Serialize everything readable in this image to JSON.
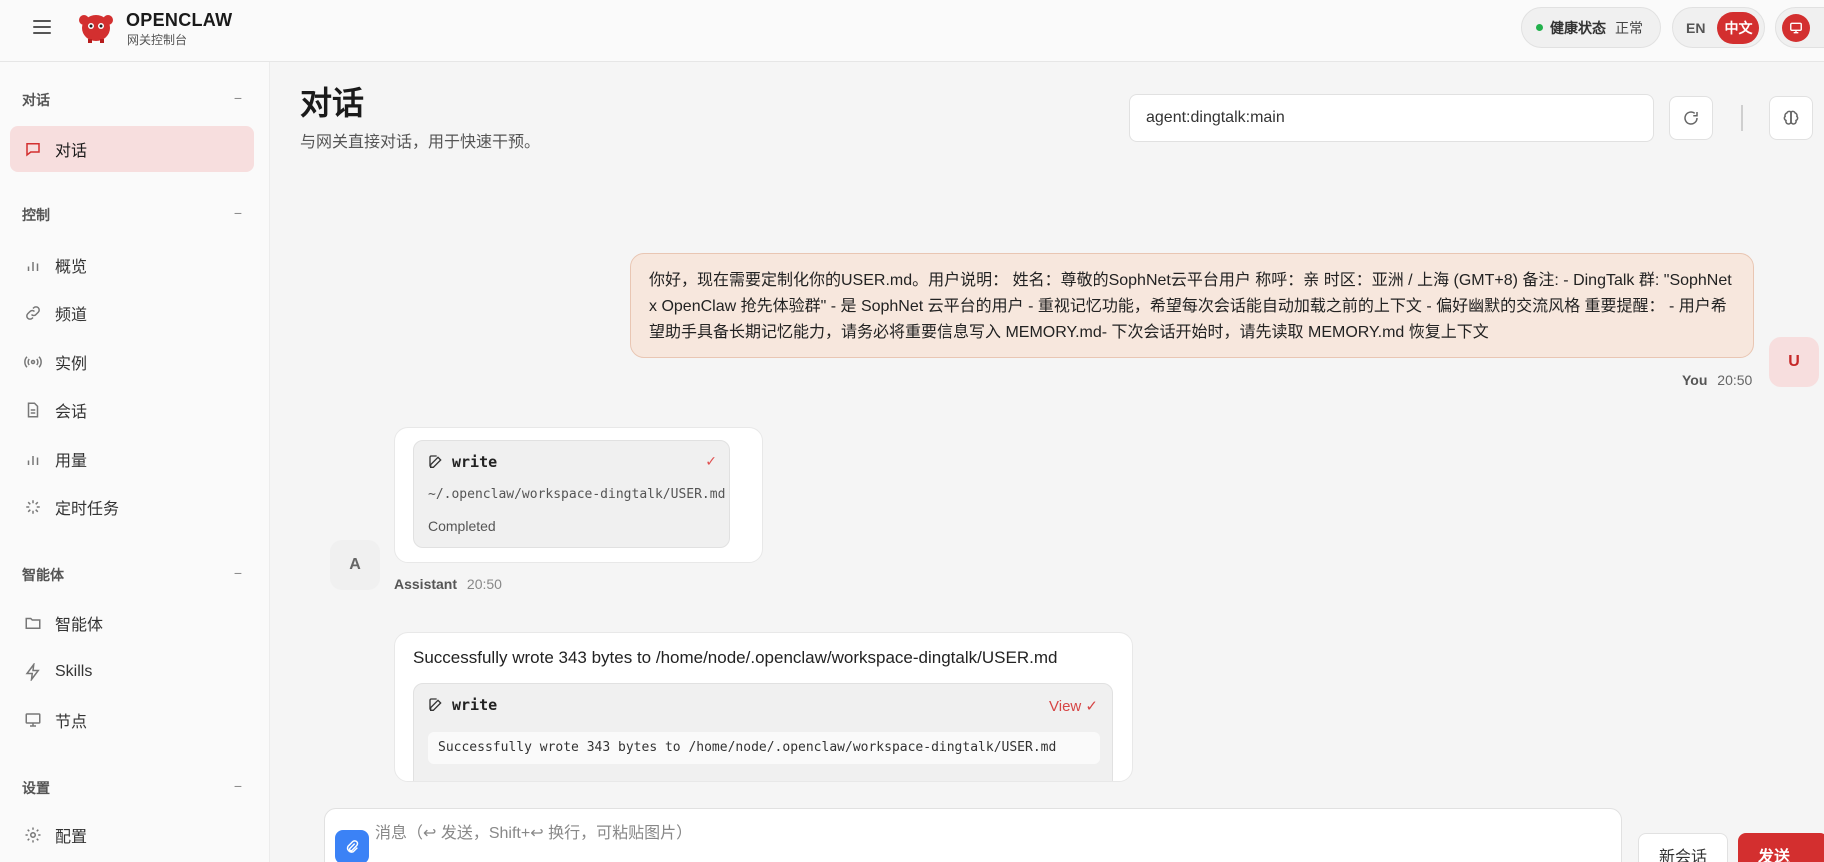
{
  "brand": {
    "name": "OPENCLAW",
    "subtitle": "网关控制台"
  },
  "topbar": {
    "health_label": "健康状态",
    "health_value": "正常",
    "health_color": "#22b14c",
    "lang_en": "EN",
    "lang_zh": "中文",
    "accent": "#d32f2f"
  },
  "sidebar": {
    "groups": [
      {
        "title": "对话",
        "collapse": "−",
        "items": [
          {
            "label": "对话",
            "icon": "chat-icon",
            "active": true
          }
        ]
      },
      {
        "title": "控制",
        "collapse": "−",
        "items": [
          {
            "label": "概览",
            "icon": "bar-chart-icon"
          },
          {
            "label": "频道",
            "icon": "link-icon"
          },
          {
            "label": "实例",
            "icon": "radio-icon"
          },
          {
            "label": "会话",
            "icon": "document-icon"
          },
          {
            "label": "用量",
            "icon": "bar-chart-icon"
          },
          {
            "label": "定时任务",
            "icon": "loader-icon"
          }
        ]
      },
      {
        "title": "智能体",
        "collapse": "−",
        "items": [
          {
            "label": "智能体",
            "icon": "folder-icon"
          },
          {
            "label": "Skills",
            "icon": "lightning-icon"
          },
          {
            "label": "节点",
            "icon": "monitor-icon"
          }
        ]
      },
      {
        "title": "设置",
        "collapse": "−",
        "items": [
          {
            "label": "配置",
            "icon": "gear-icon"
          }
        ]
      }
    ]
  },
  "main": {
    "title": "对话",
    "subtitle": "与网关直接对话，用于快速干预。",
    "session_value": "agent:dingtalk:main"
  },
  "messages": {
    "user": {
      "avatar": "U",
      "text": "你好，现在需要定制化你的USER.md。用户说明： 姓名：尊敬的SophNet云平台用户 称呼：亲 时区：亚洲 / 上海 (GMT+8) 备注: - DingTalk 群: \"SophNet x OpenClaw 抢先体验群\" - 是 SophNet 云平台的用户 - 重视记忆功能，希望每次会话能自动加载之前的上下文 - 偏好幽默的交流风格 重要提醒： - 用户希望助手具备长期记忆能力，请务必将重要信息写入 MEMORY.md- 下次会话开始时，请先读取 MEMORY.md 恢复上下文",
      "sender": "You",
      "time": "20:50"
    },
    "assistant": {
      "avatar": "A",
      "sender": "Assistant",
      "time": "20:50",
      "tool1": {
        "name": "write",
        "path": "~/.openclaw/workspace-dingtalk/USER.md",
        "status": "Completed"
      },
      "result_text": "Successfully wrote 343 bytes to /home/node/.openclaw/workspace-dingtalk/USER.md",
      "tool2": {
        "name": "write",
        "view": "View",
        "output": "Successfully wrote 343 bytes to /home/node/.openclaw/workspace-dingtalk/USER.md"
      }
    }
  },
  "composer": {
    "placeholder": "消息（↩ 发送，Shift+↩ 换行，可粘贴图片）",
    "new_session": "新会话",
    "send": "发送"
  }
}
